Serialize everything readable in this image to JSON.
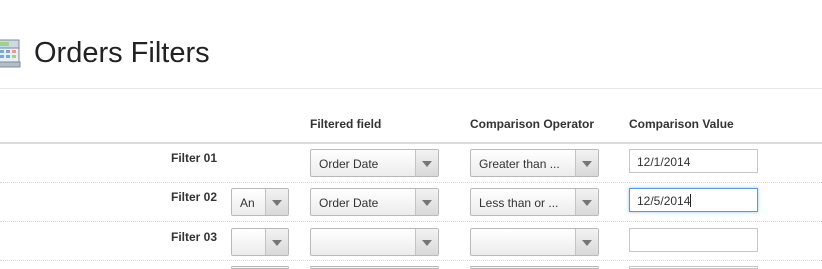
{
  "page": {
    "title": "Orders Filters"
  },
  "columns": {
    "filtered_field": "Filtered field",
    "comparison_operator": "Comparison Operator",
    "comparison_value": "Comparison Value"
  },
  "filters": [
    {
      "label": "Filter 01",
      "conjunction": null,
      "field": "Order Date",
      "operator": "Greater than ...",
      "value": "12/1/2014"
    },
    {
      "label": "Filter 02",
      "conjunction": "An",
      "field": "Order Date",
      "operator": "Less than or ...",
      "value": "12/5/2014"
    },
    {
      "label": "Filter 03",
      "conjunction": "",
      "field": "",
      "operator": "",
      "value": ""
    }
  ],
  "icons": {
    "page": "cash-register-icon",
    "dropdown": "chevron-down-icon"
  },
  "colors": {
    "focus_border": "#5b9bd5",
    "header_rule": "#dcdcdc"
  }
}
